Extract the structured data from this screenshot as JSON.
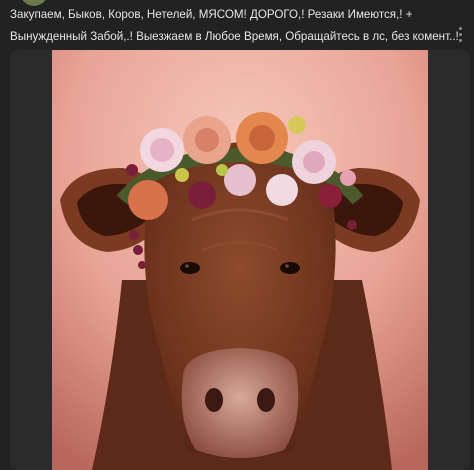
{
  "post": {
    "text": "Закупаем, Быков, Коров, Нетелей, МЯСОМ! ДОРОГО,! Резаки Имеются,! +\nВынужденный Забой,.! Выезжаем в Любое Время, Обращайтесь в лс, без комент..!",
    "menu_icon": "more-vertical-icon"
  },
  "photo": {
    "subject": "cow-with-flower-crown",
    "colors": {
      "background": "#e7a99c",
      "fur": "#7a3a22",
      "flowers": "#d9826b"
    }
  }
}
